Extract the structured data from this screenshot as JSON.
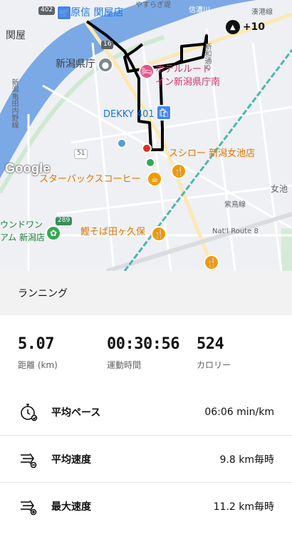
{
  "map": {
    "badge_text": "+10",
    "google_logo": "Google",
    "labels": {
      "hara_shin": "原信 関屋店",
      "sekiya": "関屋",
      "yasuragi": "やすらぎ堤",
      "shinano_kawa": "信濃川",
      "minato": "湊港線",
      "niigata_pref": "新潟県庁",
      "hotel": "ホテルルート",
      "hotel2": "イン新潟県庁南",
      "dekky": "DEKKY 401",
      "sushiro": "スシロー 新潟女池店",
      "starbucks": "スターバックスコーヒー",
      "onnaike": "女池",
      "shiba": "紫鳥線",
      "katsuo": "鰹そば田ヶ久保",
      "natl": "Nat'l Route 8",
      "wunwun": "ウンドワン",
      "wunwun2": "アム 新潟店",
      "kameda": "新潟亀田内野線",
      "shinkawa": "新和通り"
    },
    "shields": {
      "r402": "402",
      "r16": "16",
      "r51": "51",
      "r289": "289"
    }
  },
  "activity": {
    "title": "ランニング"
  },
  "stats": {
    "distance_value": "5.07",
    "distance_label": "距離 (km)",
    "time_value": "00:30:56",
    "time_label": "運動時間",
    "calories_value": "524",
    "calories_label": "カロリー"
  },
  "metrics": [
    {
      "label": "平均ペース",
      "value": "06:06 min/km",
      "icon": "stopwatch-icon"
    },
    {
      "label": "平均速度",
      "value": "9.8 km毎時",
      "icon": "speed-average-icon"
    },
    {
      "label": "最大速度",
      "value": "11.2 km毎時",
      "icon": "speed-max-icon"
    }
  ],
  "colors": {
    "route": "#000000",
    "river": "#7aa9e6",
    "start_marker": "#34a853",
    "end_marker": "#d93025",
    "railway": "#4db6ac"
  }
}
